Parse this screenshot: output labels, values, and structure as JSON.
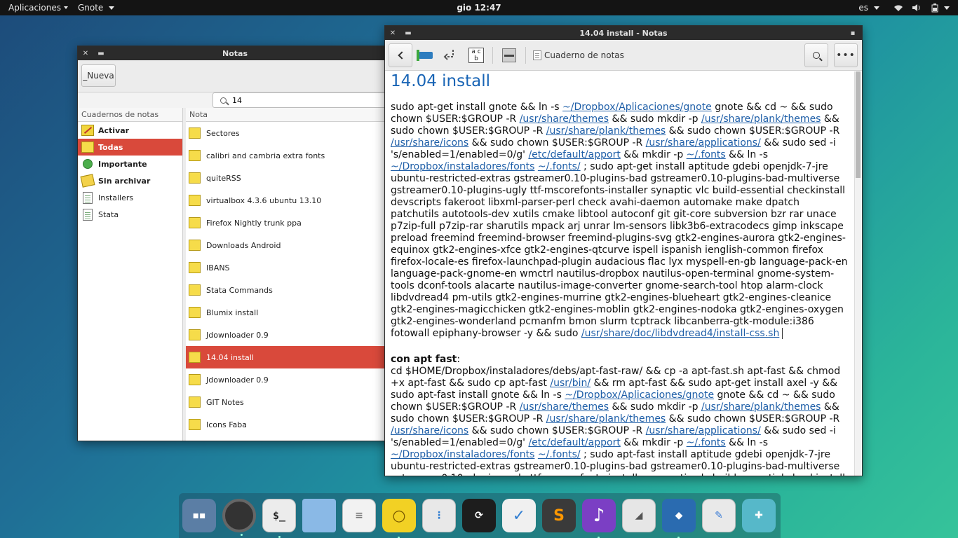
{
  "panel": {
    "apps_menu": "Aplicaciones",
    "app_menu": "Gnote",
    "clock": "gio 12:47",
    "lang": "es"
  },
  "list_window": {
    "title": "Notas",
    "new_button": "_Nueva",
    "search_value": "14",
    "notebooks_header": "Cuadernos de notas",
    "notes_header": "Nota",
    "notebooks": [
      {
        "label": "Activar",
        "icon": "pencil-notebook-icon"
      },
      {
        "label": "Todas",
        "icon": "folder-icon"
      },
      {
        "label": "Importante",
        "icon": "important-icon"
      },
      {
        "label": "Sin archivar",
        "icon": "unfiled-icon"
      },
      {
        "label": "Installers",
        "icon": "notebook-page-icon"
      },
      {
        "label": "Stata",
        "icon": "notebook-page-icon"
      }
    ],
    "notes": [
      "Sectores",
      "calibri and cambria extra fonts",
      "quiteRSS",
      "virtualbox 4.3.6 ubuntu 13.10",
      "Firefox Nightly trunk ppa",
      "Downloads Android",
      "IBANS",
      "Stata Commands",
      "Blumix install",
      "Jdownloader 0.9",
      "14.04 install",
      "Jdownloader 0.9",
      "GIT Notes",
      "Icons Faba"
    ],
    "selected_note_index": 10
  },
  "note_window": {
    "title": "14.04 install - Notas",
    "notebook_button": "Cuaderno de notas",
    "note_title": "14.04 install",
    "p1": {
      "t1": "sudo apt-get install gnote && ln -s ",
      "l1": "~/Dropbox/Aplicaciones/gnote",
      "t2": " gnote && cd ~ && sudo chown $USER:$GROUP -R ",
      "l2": "/usr/share/themes",
      "t3": " && sudo mkdir -p ",
      "l3": "/usr/share/plank/themes",
      "t4": "  && sudo chown $USER:$GROUP -R ",
      "l4": "/usr/share/plank/themes",
      "t5": " && sudo chown $USER:$GROUP -R ",
      "l5": "/usr/share/icons",
      "t6": " && sudo chown $USER:$GROUP -R ",
      "l6": "/usr/share/applications/",
      "t7": " && sudo sed -i 's/enabled=1/enabled=0/g' ",
      "l7": "/etc/default/apport",
      "t8": " && mkdir -p  ",
      "l8": "~/.fonts",
      "t9": " && ln -s ",
      "l9": "~/Dropbox/instaladores/fonts",
      "t10": " ",
      "l10": "~/.fonts/",
      "t11": " ; sudo apt-get install aptitude gdebi openjdk-7-jre ubuntu-restricted-extras gstreamer0.10-plugins-bad gstreamer0.10-plugins-bad-multiverse gstreamer0.10-plugins-ugly ttf-mscorefonts-installer synaptic vlc build-essential checkinstall devscripts fakeroot libxml-parser-perl check avahi-daemon automake make dpatch patchutils autotools-dev xutils cmake libtool autoconf git git-core subversion bzr rar unace p7zip-full p7zip-rar sharutils mpack arj unrar lm-sensors libk3b6-extracodecs gimp inkscape preload freemind freemind-browser freemind-plugins-svg gtk2-engines-aurora gtk2-engines-equinox gtk2-engines-xfce gtk2-engines-qtcurve ispell ispanish ienglish-common firefox firefox-locale-es firefox-launchpad-plugin  audacious flac lyx myspell-en-gb language-pack-en language-pack-gnome-en wmctrl nautilus-dropbox nautilus-open-terminal gnome-system-tools dconf-tools alacarte nautilus-image-converter  gnome-search-tool htop alarm-clock libdvdread4 pm-utils gtk2-engines-murrine gtk2-engines-blueheart gtk2-engines-cleanice gtk2-engines-magicchicken gtk2-engines-moblin gtk2-engines-nodoka gtk2-engines-oxygen gtk2-engines-wonderland pcmanfm bmon slurm tcptrack libcanberra-gtk-module:i386 fotowall epiphany-browser -y && sudo ",
      "l11": "/usr/share/doc/libdvdread4/install-css.sh"
    },
    "p2": {
      "heading": "con apt fast",
      "colon": ":",
      "t1": "cd $HOME/Dropbox/instaladores/debs/apt-fast-raw/ && cp -a apt-fast.sh apt-fast && chmod +x apt-fast && sudo cp apt-fast ",
      "l1": "/usr/bin/",
      "t2": " && rm apt-fast && sudo apt-get install axel -y && sudo apt-fast install gnote && ln -s ",
      "l2": "~/Dropbox/Aplicaciones/gnote",
      "t3": " gnote && cd ~ && sudo chown $USER:$GROUP -R ",
      "l3": "/usr/share/themes",
      "t4": " && sudo mkdir -p ",
      "l4": "/usr/share/plank/themes",
      "t5": "  && sudo chown $USER:$GROUP -R ",
      "l5": "/usr/share/plank/themes",
      "t6": " && sudo chown $USER:$GROUP -R ",
      "l6": "/usr/share/icons",
      "t7": " && sudo chown $USER:$GROUP -R ",
      "l7": "/usr/share/applications/",
      "t8": " && sudo sed -i 's/enabled=1/enabled=0/g' ",
      "l8": "/etc/default/apport",
      "t9": " && mkdir -p  ",
      "l9": "~/.fonts",
      "t10": " && ln -s ",
      "l10": "~/Dropbox/instaladores/fonts",
      "t11": " ",
      "l11": "~/.fonts/",
      "t12": " ; sudo apt-fast install aptitude gdebi openjdk-7-jre ubuntu-restricted-extras gstreamer0.10-plugins-bad gstreamer0.10-plugins-bad-multiverse gstreamer0.10-plugins-ugly ttf-mscorefonts-installer synaptic vlc build-essential checkinstall devscripts fakeroot libxml-parser-perl check avahi-daemon automake make dpatch patchutils autotools-dev xutils cmake libtool autoconf git git-core subversion bzr rar unace"
    }
  },
  "dock": [
    "workspace-switcher-icon",
    "camera-app-icon",
    "terminal-app-icon",
    "files-app-icon",
    "text-editor-app-icon",
    "notes-bulb-app-icon",
    "settings-app-icon",
    "screenshot-app-icon",
    "tasks-app-icon",
    "sublime-app-icon",
    "music-app-icon",
    "system-monitor-app-icon",
    "virtualbox-app-icon",
    "writer-app-icon",
    "puzzle-app-icon"
  ],
  "colors": {
    "selection": "#d9493b",
    "link": "#1f5fa8",
    "title_blue": "#1864b5"
  }
}
